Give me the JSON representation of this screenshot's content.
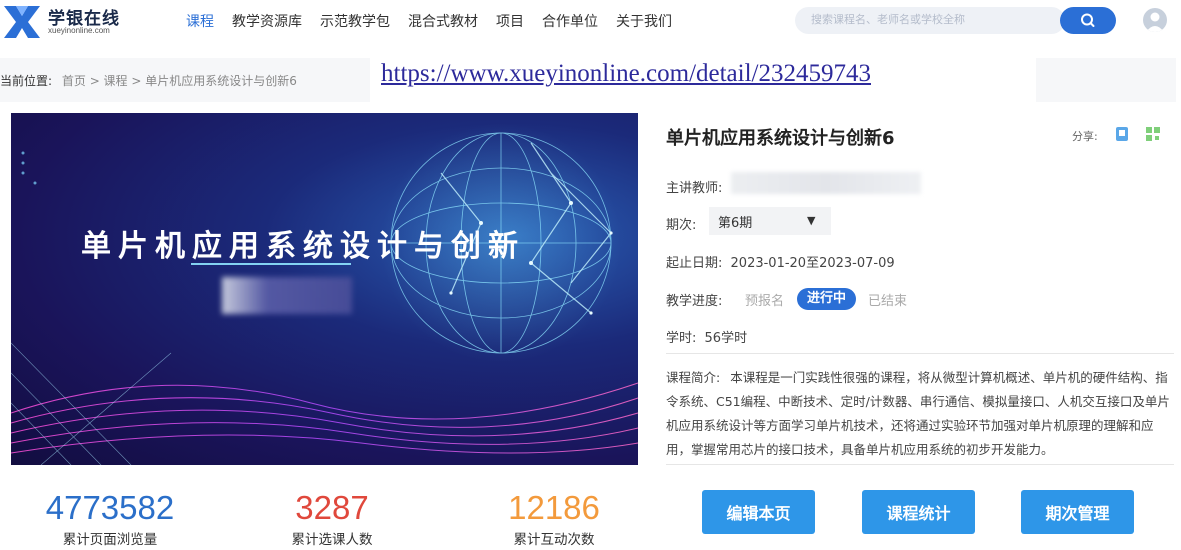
{
  "brand": {
    "name": "学银在线",
    "domain": "xueyinonline.com",
    "color": "#2b6fd6"
  },
  "nav": {
    "items": [
      {
        "label": "课程",
        "active": true
      },
      {
        "label": "教学资源库",
        "active": false
      },
      {
        "label": "示范教学包",
        "active": false
      },
      {
        "label": "混合式教材",
        "active": false
      },
      {
        "label": "项目",
        "active": false
      },
      {
        "label": "合作单位",
        "active": false
      },
      {
        "label": "关于我们",
        "active": false
      }
    ]
  },
  "search": {
    "placeholder": "搜索课程名、老师名或学校全称",
    "button_icon": "search-icon"
  },
  "breadcrumb": {
    "label": "当前位置:",
    "path": "首页 > 课程 > 单片机应用系统设计与创新6"
  },
  "url": "https://www.xueyinonline.com/detail/232459743",
  "banner": {
    "title": "单片机应用系统设计与创新"
  },
  "course": {
    "title": "单片机应用系统设计与创新6",
    "share_label": "分享:",
    "teacher_label": "主讲教师:",
    "period_label": "期次:",
    "period_value": "第6期",
    "dates_label": "起止日期:",
    "dates_value": "2023-01-20至2023-07-09",
    "progress_label": "教学进度:",
    "status": {
      "pre": "预报名",
      "on": "进行中",
      "done": "已结束"
    },
    "hours_label": "学时:",
    "hours_value": "56学时",
    "intro_label": "课程简介:",
    "intro_text": "本课程是一门实践性很强的课程，将从微型计算机概述、单片机的硬件结构、指令系统、C51编程、中断技术、定时/计数器、串行通信、模拟量接口、人机交互接口及单片机应用系统设计等方面学习单片机技术，还将通过实验环节加强对单片机原理的理解和应用，掌握常用芯片的接口技术，具备单片机应用系统的初步开发能力。"
  },
  "stats": [
    {
      "value": "4773582",
      "label": "累计页面浏览量",
      "color": "#2b6fc9"
    },
    {
      "value": "3287",
      "label": "累计选课人数",
      "color": "#e0483c"
    },
    {
      "value": "12186",
      "label": "累计互动次数",
      "color": "#f39a3c"
    }
  ],
  "actions": {
    "edit": "编辑本页",
    "stats": "课程统计",
    "periods": "期次管理"
  }
}
